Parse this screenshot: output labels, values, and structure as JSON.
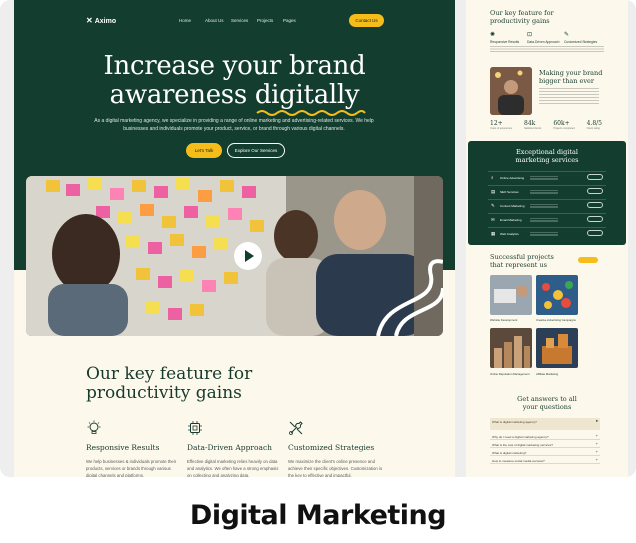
{
  "caption": "Digital Marketing",
  "main": {
    "nav": {
      "logo": "Aximo",
      "links": [
        "Home",
        "About Us",
        "Services",
        "Projects",
        "Pages"
      ],
      "cta": "Contact Us"
    },
    "hero": {
      "title_line1": "Increase your brand",
      "title_line2_a": "awareness ",
      "title_line2_b": "digitally",
      "subtitle": "As a digital marketing agency, we specialize in providing a range of online marketing and advertising-related services. We help businesses and individuals promote your product, service, or brand through various digital channels.",
      "primary_button": "Let's Talk",
      "secondary_button": "Explore Our Services"
    },
    "key_features": {
      "title_line1": "Our key feature for",
      "title_line2": "productivity gains",
      "items": [
        {
          "icon": "lightbulb-icon",
          "title": "Responsive Results",
          "desc": "We help businesses & individuals promote their products, services or brands through various digital channels and platforms."
        },
        {
          "icon": "chip-icon",
          "title": "Data-Driven Approach",
          "desc": "Effective digital marketing relies heavily on data and analytics. We often have a strong emphasis on collecting and analyzing data."
        },
        {
          "icon": "tools-icon",
          "title": "Customized Strategies",
          "desc": "We maximize the client's online presence and achieve their specific objectives. Customization is the key to effective and impactful."
        }
      ]
    }
  },
  "side": {
    "key_title": "Our key feature for productivity gains",
    "mini_features": [
      "Responsive Results",
      "Data-Driven Approach",
      "Customized Strategies"
    ],
    "bigger_title": "Making your brand bigger than ever",
    "stats": [
      {
        "n": "12+",
        "l": "Years of experience"
      },
      {
        "n": "84k",
        "l": "Satisfied clients"
      },
      {
        "n": "60k+",
        "l": "Projects completed"
      },
      {
        "n": "4.8/5",
        "l": "Client rating"
      }
    ],
    "services_title": "Exceptional digital marketing services",
    "services": [
      {
        "icon": "search-icon",
        "name": "Online Advertising"
      },
      {
        "icon": "chart-icon",
        "name": "SEO Services"
      },
      {
        "icon": "pen-icon",
        "name": "Content Marketing"
      },
      {
        "icon": "mail-icon",
        "name": "Email Marketing"
      },
      {
        "icon": "grid-icon",
        "name": "Web Analytics"
      }
    ],
    "projects_title": "Successful projects that represent us",
    "projects": [
      {
        "label": "Website Development"
      },
      {
        "label": "Creative Advertising Campaigns"
      },
      {
        "label": "Online Reputation Management"
      },
      {
        "label": "Affiliate Marketing"
      }
    ],
    "faq_title": "Get answers to all your questions",
    "faqs": [
      "What is digital marketing agency?",
      "Why do I need a digital marketing agency?",
      "What is the cost of digital marketing services?",
      "What is digital marketing?",
      "How to measure social media success?"
    ]
  }
}
